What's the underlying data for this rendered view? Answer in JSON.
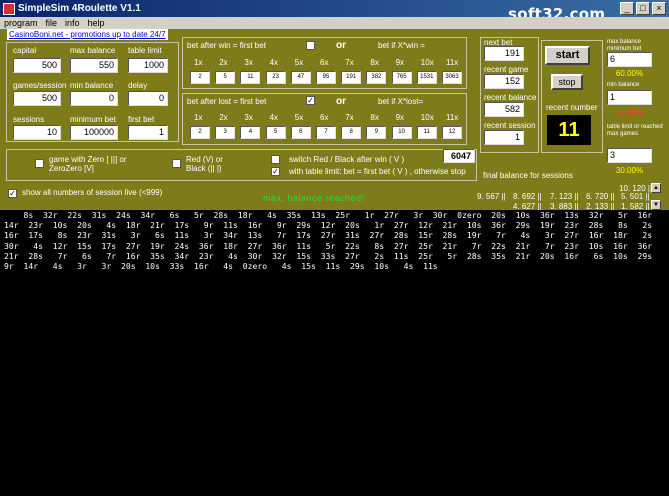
{
  "window": {
    "title": "SimpleSim 4Roulette V1.1",
    "watermark": "soft32.com",
    "min": "_",
    "max": "□",
    "close": "×"
  },
  "menu": [
    "program",
    "file",
    "info",
    "help"
  ],
  "promo_link": "CasinoBoni.net - promotions up to date 24/7",
  "fields": {
    "capital": {
      "label": "capital",
      "value": "500"
    },
    "max_balance": {
      "label": "max balance",
      "value": "550"
    },
    "table_limit": {
      "label": "table limit",
      "value": "1000"
    },
    "games_session": {
      "label": "games/session",
      "value": "500"
    },
    "min_balance": {
      "label": "min balance",
      "value": "0"
    },
    "delay": {
      "label": "delay",
      "value": "0"
    },
    "sessions": {
      "label": "sessions",
      "value": "10"
    },
    "minimum_bet": {
      "label": "minimum bet",
      "value": "100000"
    },
    "first_bet": {
      "label": "first bet",
      "value": "1"
    }
  },
  "win_group": {
    "title": "bet after win = first bet",
    "or": "or",
    "alt": "bet if X*win =",
    "multipliers": [
      "1x",
      "2x",
      "3x",
      "4x",
      "5x",
      "6x",
      "7x",
      "8x",
      "9x",
      "10x",
      "11x"
    ],
    "values": [
      "2",
      "5",
      "11",
      "23",
      "47",
      "95",
      "191",
      "382",
      "765",
      "1531",
      "3063"
    ]
  },
  "lost_group": {
    "title": "bet after lost = first bet",
    "or": "or",
    "alt": "bet if X*lost=",
    "multipliers": [
      "1x",
      "2x",
      "3x",
      "4x",
      "5x",
      "6x",
      "7x",
      "8x",
      "9x",
      "10x",
      "11x"
    ],
    "values": [
      "2",
      "3",
      "4",
      "5",
      "6",
      "7",
      "8",
      "9",
      "10",
      "11",
      "12"
    ]
  },
  "recent": {
    "next_bet": {
      "label": "next bet",
      "value": "191"
    },
    "recent_game": {
      "label": "recent game",
      "value": "152"
    },
    "recent_balance": {
      "label": "recent balance",
      "value": "582"
    },
    "recent_session": {
      "label": "recent session",
      "value": "1"
    }
  },
  "controls": {
    "start": "start",
    "stop": "stop",
    "recent_number_label": "recent number",
    "recent_number": "11"
  },
  "right_stats": {
    "max_balance_label": "max balance minimum bet",
    "max_balance_value": "6",
    "max_balance_pct": "60.00%",
    "min_balance_label": "min balance",
    "min_balance_value": "1",
    "min_balance_pct": "10.00%",
    "table_limit_label": "table limit or reached max games",
    "table_limit_value": "3",
    "table_limit_pct": "30.00%"
  },
  "options": {
    "zero_game": "game with Zero [ ||] or ZeroZero [V]",
    "red_black": "Red (V) or Black (|| |)",
    "switch_red_black": "switch Red / Black after win ( V )",
    "table_limit_rule": "with table limit: bet = first bet ( V ) , otherwise stop",
    "counter": "6047",
    "final_balance": "final balance for sessions",
    "show_all": "show all numbers of session live (<999)",
    "message": "max. balance reached!"
  },
  "session_stats": {
    "row1": [
      "9. 567 ||",
      "8. 692 ||",
      "7. 123 ||",
      "6. 720 ||",
      "5. 501 ||",
      "10. 120 ||"
    ],
    "row2": [
      "4. 627 ||",
      "3. 883 ||",
      "2. 133 ||",
      "1. 582 ||"
    ]
  },
  "log_lines": [
    "    8s  32r  22s  31s  24s  34r   6s   5r  28s  18r   4s  35s  13s  25r   1r  27r   3r  30r  0zero  20s  10s  36r  13s  32r   5r  16r",
    "14r  23r  10s  20s   4s  18r  21r  17s   9r  11s  16r   9r  29s  12r  20s   1r  27r  12r  21r  10s  36r  29s  19r  23r  28s   8s   2s",
    "16r  17s   8s  23r  31s   3r   6s  11s   3r  34r  13s   7r  17s  27r  31s  27r  28s  15r  28s  19r   7r   4s   3r  27r  16r  18r   2s",
    "30r   4s  12r  15s  17s  27r  19r  24s  36r  18r  27r  36r  11s   5r  22s   8s  27r  25r  21r   7r  22s  21r   7r  23r  10s  16r  36r",
    "21r  28s   7r   6s   7r  16r  35s  34r  23r   4s  30r  32r  15s  33s  27r   2s  11s  25r   5r  28s  35s  21r  20s  16r   6s  10s  29s",
    "9r  14r   4s   3r   3r  20s  10s  33s  16r   4s  0zero   4s  15s  11s  29s  10s   4s  11s"
  ]
}
